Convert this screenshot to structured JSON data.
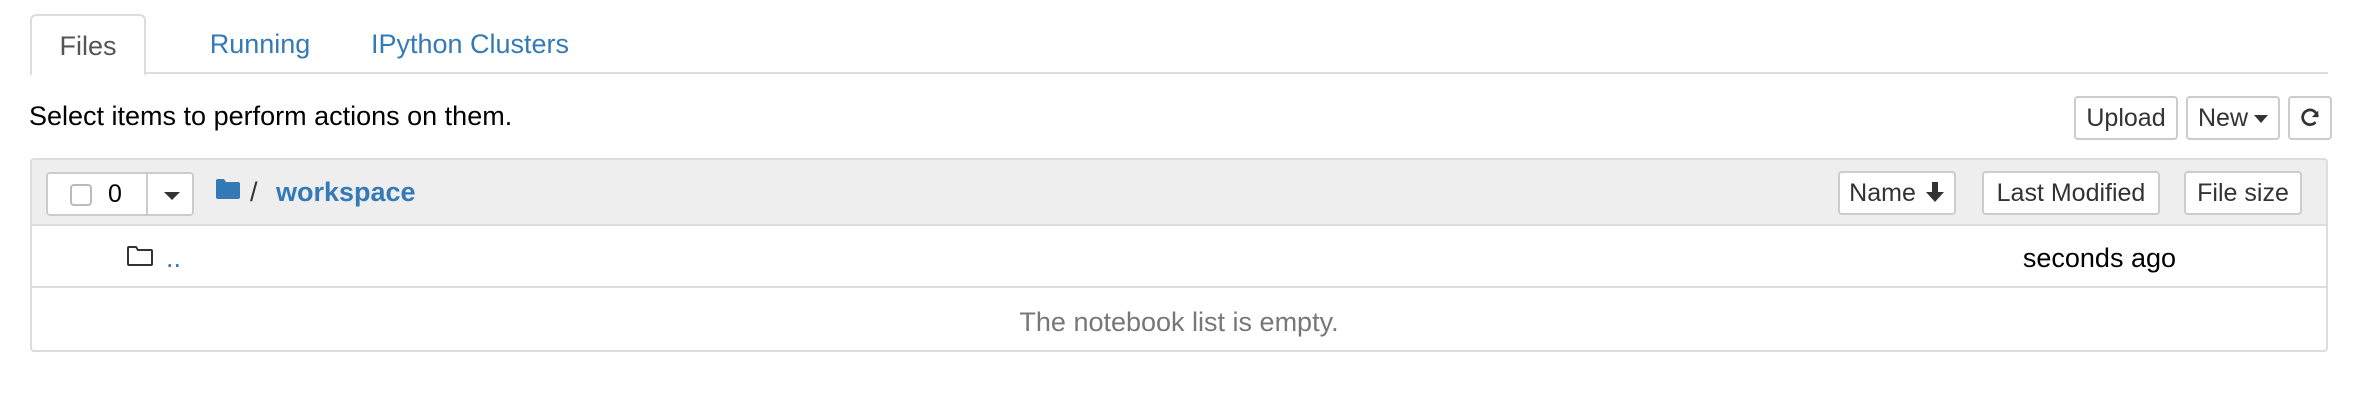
{
  "tabs": [
    {
      "label": "Files",
      "active": true
    },
    {
      "label": "Running",
      "active": false
    },
    {
      "label": "IPython Clusters",
      "active": false
    }
  ],
  "toolbar": {
    "hint": "Select items to perform actions on them.",
    "upload_label": "Upload",
    "new_label": "New",
    "refresh_icon": "refresh-icon"
  },
  "list": {
    "selected_count": "0",
    "breadcrumb": {
      "separator": "/",
      "directory": "workspace"
    },
    "sort": {
      "name_label": "Name",
      "last_modified_label": "Last Modified",
      "file_size_label": "File size"
    },
    "rows": [
      {
        "name": "..",
        "modified": "seconds ago",
        "icon": "folder-icon"
      }
    ],
    "empty_message": "The notebook list is empty."
  },
  "colors": {
    "link": "#337ab7",
    "header_bg": "#eeeeee",
    "border": "#dddddd",
    "muted": "#777777"
  }
}
